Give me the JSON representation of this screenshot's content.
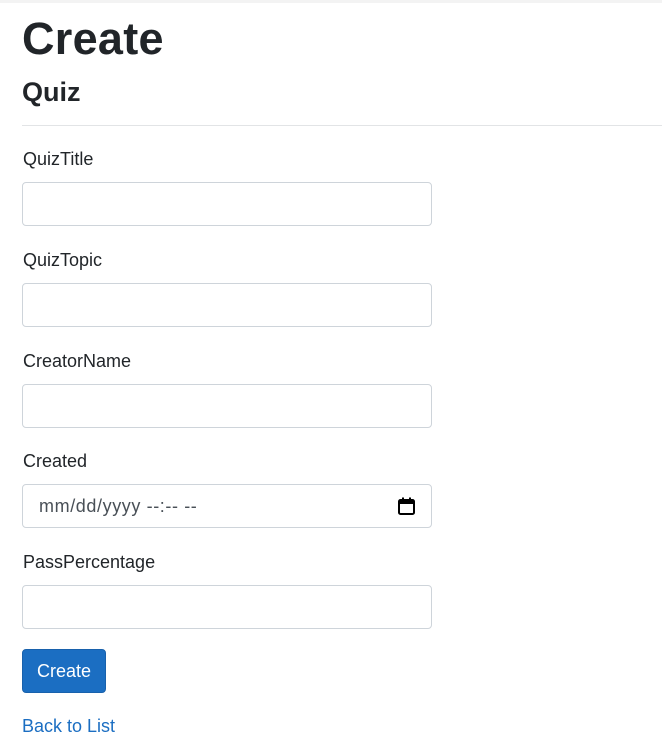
{
  "header": {
    "title": "Create",
    "subtitle": "Quiz"
  },
  "form": {
    "fields": [
      {
        "label": "QuizTitle",
        "value": "",
        "placeholder": ""
      },
      {
        "label": "QuizTopic",
        "value": "",
        "placeholder": ""
      },
      {
        "label": "CreatorName",
        "value": "",
        "placeholder": ""
      },
      {
        "label": "Created",
        "value": "mm/dd/yyyy --:-- --",
        "icon": "calendar-icon"
      },
      {
        "label": "PassPercentage",
        "value": "",
        "placeholder": ""
      }
    ],
    "submit_label": "Create"
  },
  "footer": {
    "back_link": "Back to List"
  },
  "colors": {
    "primary": "#1b6ec2",
    "text": "#212529",
    "border": "#ced4da"
  }
}
